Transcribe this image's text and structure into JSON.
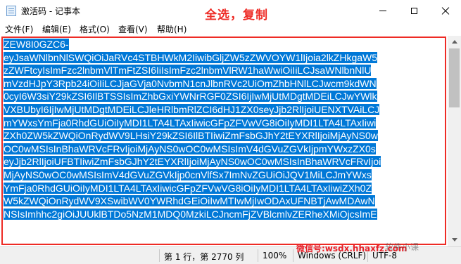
{
  "window": {
    "title": "激活码 - 记事本",
    "annotation": "全选，复制"
  },
  "menu": [
    "文件(F)",
    "编辑(E)",
    "格式(O)",
    "查看(V)",
    "帮助(H)"
  ],
  "editor": {
    "lines": [
      "ZEW8I0GZC6-",
      "eyJsaWNlbnNlSWQiOiJaRVc4STBHWkM2IiwibGljZW5zZWVOYW1lIjoia2lkZHkgaW5",
      "zZWFtcyIsImFzc2lnbmVlTmFtZSI6IiIsImFzc2lnbmVlRW1haWwiOiIiLCJsaWNlbnNlU",
      "mVzdHJpY3Rpb24iOiIiLCJjaGVja0NvbmN1cnJlbnRVc2UiOmZhbHNlLCJwcm9kdWN",
      "0cyI6W3siY29kZSI6IlBTSSIsImZhbGxiYWNrRGF0ZSI6IjIwMjUtMDgtMDEiLCJwYWlk",
      "VXBUbyI6IjIwMjUtMDgtMDEiLCJleHRlbmRlZCI6dHJ1ZX0seyJjb2RlIjoiUENXTVAiLCJ",
      "mYWxsYmFja0RhdGUiOiIyMDI1LTA4LTAxIiwicGFpZFVwVG8iOiIyMDI1LTA4LTAxIiwi",
      "ZXh0ZW5kZWQiOnRydWV9LHsiY29kZSI6IlBTIiwiZmFsbGJhY2tEYXRlIjoiMjAyNS0w",
      "OC0wMSIsInBhaWRVcFRvIjoiMjAyNS0wOC0wMSIsImV4dGVuZGVkIjpmYWxzZX0s",
      "eyJjb2RlIjoiUFBTIiwiZmFsbGJhY2tEYXRlIjoiMjAyNS0wOC0wMSIsInBhaWRVcFRvIjoi",
      "MjAyNS0wOC0wMSIsImV4dGVuZGVkIjp0cnVlfSx7ImNvZGUiOiJQV1MiLCJmYWxs",
      "YmFja0RhdGUiOiIyMDI1LTA4LTAxIiwicGFpZFVwVG8iOiIyMDI1LTA4LTAxIiwiZXh0Z",
      "W5kZWQiOnRydWV9XSwibWV0YWRhdGEiOiIwMTIwMjIwODAxUFNBTjAwMDAwN",
      "NSIsImhhc2giOiJUUklBTDo5NzM1MDQ0MzkiLCJncmFjZVBlcmlvZERheXMiOjcsImE"
    ]
  },
  "status": {
    "position": "第 1 行，第 2770 列",
    "zoom": "100%",
    "line_ending": "Windows (CRLF)",
    "encoding": "UTF-8"
  },
  "watermark": {
    "brand": "微信号:wsdx.hhaxfz.com",
    "sub": "软件小课"
  }
}
